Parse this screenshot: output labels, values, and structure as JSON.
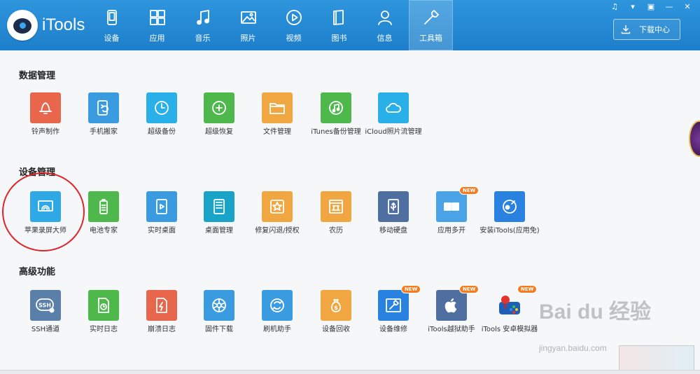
{
  "app": {
    "name": "iTools"
  },
  "nav": [
    {
      "label": "设备",
      "icon": "device-icon"
    },
    {
      "label": "应用",
      "icon": "apps-icon"
    },
    {
      "label": "音乐",
      "icon": "music-icon"
    },
    {
      "label": "照片",
      "icon": "photo-icon"
    },
    {
      "label": "视频",
      "icon": "video-icon"
    },
    {
      "label": "图书",
      "icon": "book-icon"
    },
    {
      "label": "信息",
      "icon": "contact-icon"
    },
    {
      "label": "工具箱",
      "icon": "toolbox-icon",
      "active": true
    }
  ],
  "window_controls": [
    "♫",
    "▾",
    "▣",
    "—",
    "✕"
  ],
  "download": {
    "label": "下载中心"
  },
  "sections": [
    {
      "title": "数据管理",
      "items": [
        {
          "label": "铃声制作",
          "color": "#e8664c",
          "icon": "bell-icon"
        },
        {
          "label": "手机搬家",
          "color": "#3b9be0",
          "icon": "phone-transfer-icon"
        },
        {
          "label": "超级备份",
          "color": "#2ab0e8",
          "icon": "backup-clock-icon"
        },
        {
          "label": "超级恢复",
          "color": "#4fb84c",
          "icon": "restore-icon"
        },
        {
          "label": "文件管理",
          "color": "#f0a741",
          "icon": "folder-icon"
        },
        {
          "label": "iTunes备份管理",
          "color": "#4fb84c",
          "icon": "itunes-backup-icon"
        },
        {
          "label": "iCloud照片流管理",
          "color": "#2ab0e8",
          "icon": "cloud-icon"
        }
      ]
    },
    {
      "title": "设备管理",
      "items": [
        {
          "label": "苹果录屏大师",
          "color": "#2fa9e6",
          "icon": "screen-mirror-icon"
        },
        {
          "label": "电池专家",
          "color": "#4fb84c",
          "icon": "battery-icon"
        },
        {
          "label": "实时桌面",
          "color": "#3b9be0",
          "icon": "live-desktop-icon"
        },
        {
          "label": "桌面管理",
          "color": "#1aa3c9",
          "icon": "desktop-grid-icon"
        },
        {
          "label": "修复闪退/授权",
          "color": "#f0a741",
          "icon": "repair-badge-icon"
        },
        {
          "label": "农历",
          "color": "#f0a741",
          "icon": "lunar-calendar-icon"
        },
        {
          "label": "移动硬盘",
          "color": "#4e6fa0",
          "icon": "usb-drive-icon"
        },
        {
          "label": "应用多开",
          "color": "#4aa3e6",
          "icon": "multi-app-icon",
          "badge": "NEW"
        },
        {
          "label": "安装iTools(应用免)",
          "color": "#2a82e0",
          "icon": "install-itools-icon"
        }
      ]
    },
    {
      "title": "高级功能",
      "items": [
        {
          "label": "SSH通道",
          "color": "#5a7fa8",
          "icon": "ssh-icon"
        },
        {
          "label": "实时日志",
          "color": "#4fb84c",
          "icon": "log-icon"
        },
        {
          "label": "崩溃日志",
          "color": "#e8664c",
          "icon": "crash-log-icon"
        },
        {
          "label": "固件下载",
          "color": "#3b9be0",
          "icon": "firmware-gear-icon"
        },
        {
          "label": "刷机助手",
          "color": "#3b9be0",
          "icon": "flash-assistant-icon"
        },
        {
          "label": "设备回收",
          "color": "#f0a741",
          "icon": "money-bag-icon"
        },
        {
          "label": "设备维修",
          "color": "#2a82e0",
          "icon": "repair-tool-icon",
          "badge": "NEW"
        },
        {
          "label": "iTools越狱助手",
          "color": "#4e6fa0",
          "icon": "apple-icon",
          "badge": "NEW"
        },
        {
          "label": "iTools 安卓模拟器",
          "color": "#2a82e0",
          "icon": "gamepad-icon",
          "badge": "NEW"
        }
      ]
    }
  ],
  "watermark": {
    "brand": "Bai du 经验",
    "url": "jingyan.baidu.com"
  }
}
